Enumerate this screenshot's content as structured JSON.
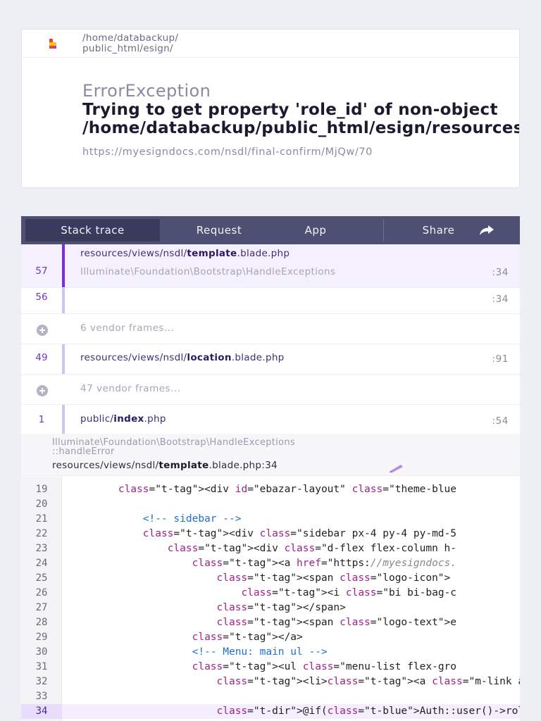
{
  "header": {
    "path_lines": [
      "/home/databackup/",
      "public_html/esign/"
    ],
    "exception_class": "ErrorException",
    "exception_message": "Trying to get property 'role_id' of non-object\n/home/databackup/public_html/esign/resources/views/nsdl/template.blade.php",
    "url": "https://myesigndocs.com/nsdl/final-confirm/MjQw/70"
  },
  "tabs": [
    {
      "label": "Stack trace",
      "active": true
    },
    {
      "label": "Request",
      "active": false
    },
    {
      "label": "App",
      "active": false
    },
    {
      "label": "Share",
      "active": false
    }
  ],
  "frames": [
    {
      "number": "57",
      "file_prefix": "resources/views/nsdl/",
      "file_name": "template",
      "file_ext": ".blade.php",
      "class": "Illuminate\\Foundation\\Bootstrap\\HandleExceptions",
      "line": ":34",
      "selected": true
    },
    {
      "number": "56",
      "line": ":34"
    },
    {
      "vendor_label": "6 vendor frames..."
    },
    {
      "number": "49",
      "file_prefix": "resources/views/nsdl/",
      "file_name": "location",
      "file_ext": ".blade.php",
      "line": ":91"
    },
    {
      "vendor_label": "47 vendor frames..."
    },
    {
      "number": "1",
      "file_prefix": "public/",
      "file_name": "index",
      "file_ext": ".php",
      "line": ":54"
    }
  ],
  "snippet": {
    "class_line1": "Illuminate\\Foundation\\Bootstrap\\HandleExceptions",
    "class_line2": "::handleError",
    "file_prefix": "resources/views/nsdl/",
    "file_name": "template",
    "file_suffix": ".blade.php:34",
    "highlight_line": 34,
    "lines": [
      {
        "n": "19",
        "text": "        <div id=\"ebazar-layout\" class=\"theme-blue"
      },
      {
        "n": "20",
        "text": ""
      },
      {
        "n": "21",
        "text": "            <!-- sidebar -->"
      },
      {
        "n": "22",
        "text": "            <div class=\"sidebar px-4 py-4 py-md-5"
      },
      {
        "n": "23",
        "text": "                <div class=\"d-flex flex-column h-"
      },
      {
        "n": "24",
        "text": "                    <a href=\"https://myesigndocs."
      },
      {
        "n": "25",
        "text": "                        <span class=\"logo-icon\">"
      },
      {
        "n": "26",
        "text": "                            <i class=\"bi bi-bag-c"
      },
      {
        "n": "27",
        "text": "                        </span>"
      },
      {
        "n": "28",
        "text": "                        <span class=\"logo-text\">e"
      },
      {
        "n": "29",
        "text": "                    </a>"
      },
      {
        "n": "30",
        "text": "                    <!-- Menu: main ul -->"
      },
      {
        "n": "31",
        "text": "                    <ul class=\"menu-list flex-gro"
      },
      {
        "n": "32",
        "text": "                        <li><a class=\"m-link acti"
      },
      {
        "n": "33",
        "text": ""
      },
      {
        "n": "34",
        "text": "                        @if(Auth::user()->role_id"
      }
    ]
  },
  "colors": {
    "accent": "#7a2ed6",
    "tabs_bg": "#4e5073",
    "tab_active_bg": "#3a3b5c",
    "highlight_bg": "#f4eefe"
  },
  "icons": [
    "flare-logo-icon",
    "share-icon",
    "expand-plus-icon",
    "pencil-edit-icon"
  ]
}
